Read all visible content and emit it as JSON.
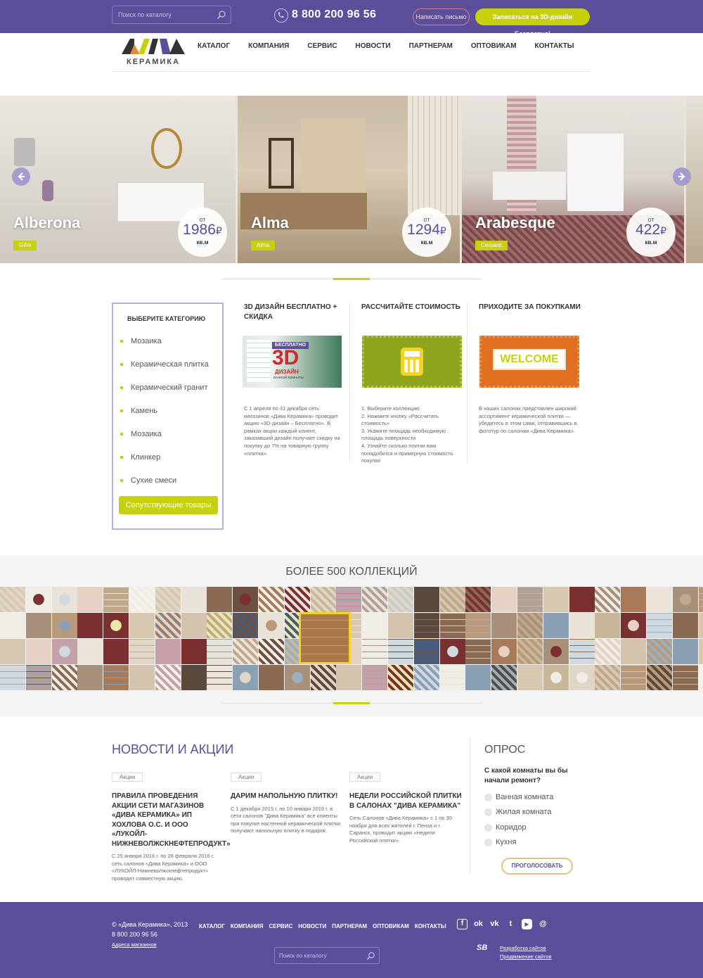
{
  "topbar": {
    "search_placeholder": "Поиск по каталогу",
    "phone": "8 800 200 96 56",
    "write_button": "Написать письмо",
    "design_button": "Записаться на 3D-дизайн Бесплатно!"
  },
  "header": {
    "logo_text": "ДИВА",
    "logo_sub": "КЕРАМИКА",
    "nav": [
      "КАТАЛОГ",
      "КОМПАНИЯ",
      "СЕРВИС",
      "НОВОСТИ",
      "ПАРТНЕРАМ",
      "ОПТОВИКАМ",
      "КОНТАКТЫ"
    ]
  },
  "slider": {
    "slides": [
      {
        "name": "Alberona",
        "tag": "Gifre",
        "price_from": "от",
        "price": "1986",
        "currency": "₽",
        "unit": "кв.м"
      },
      {
        "name": "Alma",
        "tag": "Alma",
        "price_from": "от",
        "price": "1294",
        "currency": "₽",
        "unit": "кв.м"
      },
      {
        "name": "Arabesque",
        "tag": "Cersanit",
        "price_from": "от",
        "price": "422",
        "currency": "₽",
        "unit": "кв.м"
      }
    ]
  },
  "categories": {
    "title": "ВЫБЕРИТЕ КАТЕГОРИЮ",
    "items": [
      "Мозаика",
      "Керамическая плитка",
      "Керамический гранит",
      "Камень",
      "Мозаика",
      "Клинкер",
      "Сухие смеси"
    ],
    "button": "Сопутствующие товары"
  },
  "promos": [
    {
      "title": "3D ДИЗАЙН БЕСПЛАТНО + СКИДКА",
      "image_big": "3D",
      "image_small_top": "БЕСПЛАТНО",
      "image_small_mid": "ДИЗАЙН",
      "image_small_bot": "ВАННОЙ КОМНАТЫ",
      "text": "С 1 апреля по 31 декабря сеть магазинов «Дива Керамика» проводит акцию «3D-дизайн – Бесплатно». В рамках акции каждый клиент, заказавший дизайн получает скидку на покупку до 7% на товарную группу «плитка»."
    },
    {
      "title": "РАССЧИТАЙТЕ СТОИМОСТЬ",
      "steps": [
        "1. Выберите коллекцию",
        "2. Нажмите кнопку «Рассчитать стоимость»",
        "3. Укажите площадь необходимую площадь поверхности",
        "4. Узнайте сколько плитки вам понадобится и примерную стоимость покупки"
      ]
    },
    {
      "title": "ПРИХОДИТЕ ЗА ПОКУПКАМИ",
      "image_text": "WELCOME",
      "text": "В наших салонах представлен широкий ассортимент керамической плитки — убедитесь в этом сами, отправившись в фототур по салонам «Дива Керамика»."
    }
  ],
  "collections": {
    "title": "БОЛЕЕ 500 КОЛЛЕКЦИЙ"
  },
  "news": {
    "title": "НОВОСТИ И АКЦИИ",
    "items": [
      {
        "badge": "Акции",
        "headline": "ПРАВИЛА ПРОВЕДЕНИЯ АКЦИИ СЕТИ МАГАЗИНОВ «ДИВА КЕРАМИКА» ИП ХОХЛОВА О.С. И ООО «ЛУКОЙЛ-НИЖНЕВОЛЖСКНЕФТЕПРОДУКТ»",
        "text": "С 25 января 2016 г. по 26 февраля 2016 г. сеть салонов «Дива Керамика» и ООО «ЛУКОЙЛ-Нижневолжскнефтепродукт» проводят совместную акцию."
      },
      {
        "badge": "Акции",
        "headline": "ДАРИМ НАПОЛЬНУЮ ПЛИТКУ!",
        "text": "С 1 декабря 2015 г. по 10 января 2016 г. в сети салонов \"Дива Керамика\" все клиенты при покупке настенной керамической плитки получают напольную плитку в подарок."
      },
      {
        "badge": "Акции",
        "headline": "НЕДЕЛИ РОССИЙСКОЙ ПЛИТКИ В САЛОНАХ \"ДИВА КЕРАМИКА\"",
        "text": "Сеть Салонов «Дива Керамика» с 1 по 30 ноября для всех жителей г. Пенза и г. Саранск, проводит акцию «Недели Российской плитки»."
      }
    ]
  },
  "poll": {
    "title": "ОПРОС",
    "question": "С какой комнаты вы бы начали ремонт?",
    "options": [
      "Ванная комната",
      "Жилая комната",
      "Коридор",
      "Кухня"
    ],
    "button": "ПРОГОЛОСОВАТЬ"
  },
  "footer": {
    "copyright": "© «Дива Керамика», 2013",
    "phone": "8 800 200 96 56",
    "addresses_link": "Адреса магазинов",
    "nav": [
      "КАТАЛОГ",
      "КОМПАНИЯ",
      "СЕРВИС",
      "НОВОСТИ",
      "ПАРТНЕРАМ",
      "ОПТОВИКАМ",
      "КОНТАКТЫ"
    ],
    "search_placeholder": "Поиск по каталогу",
    "studio_logo": "SB",
    "dev_link": "Разработка сайтов",
    "promo_link": "Продвижение сайтов"
  },
  "colors": {
    "brand_purple": "#5b4e9a",
    "accent_lime": "#c6d10c",
    "highlight_yellow": "#f3d326"
  },
  "icons": [
    "search-icon",
    "phone-icon",
    "arrow-left-icon",
    "arrow-right-icon",
    "facebook-icon",
    "odnoklassniki-icon",
    "vk-icon",
    "twitter-icon",
    "youtube-icon",
    "email-icon"
  ]
}
